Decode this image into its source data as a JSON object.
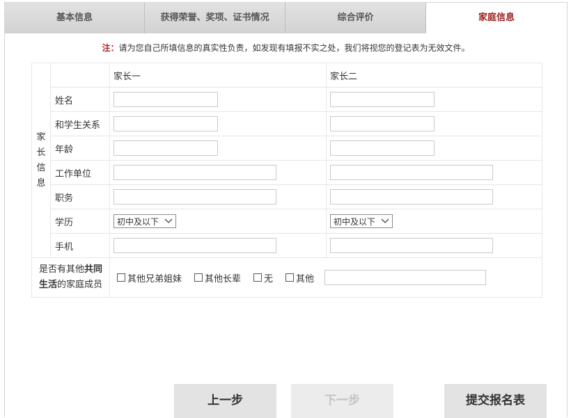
{
  "tabs": [
    "基本信息",
    "获得荣誉、奖项、证书情况",
    "综合评价",
    "家庭信息"
  ],
  "active_tab_color": "#9b1c1c",
  "notice": {
    "tag": "注：",
    "text": "请为您自己所填信息的真实性负责，如发现有填报不实之处，我们将视您的登记表为无效文件。"
  },
  "parent_section": {
    "label_chars": [
      "家",
      "长",
      "信",
      "息"
    ]
  },
  "columns": {
    "parent1": "家长一",
    "parent2": "家长二"
  },
  "rows": {
    "name": "姓名",
    "relation": "和学生关系",
    "age": "年龄",
    "work": "工作单位",
    "position": "职务",
    "education": "学历",
    "phone": "手机"
  },
  "education": {
    "parent1_selected": "初中及以下",
    "parent2_selected": "初中及以下"
  },
  "other_members": {
    "label_part1": "是否有其他",
    "label_bold1": "共同",
    "label_bold2": "生活",
    "label_part2": "的家庭成员",
    "options": [
      "其他兄弟姐妹",
      "其他长辈",
      "无",
      "其他"
    ]
  },
  "buttons": {
    "prev": "上一步",
    "next": "下一步",
    "submit": "提交报名表"
  }
}
